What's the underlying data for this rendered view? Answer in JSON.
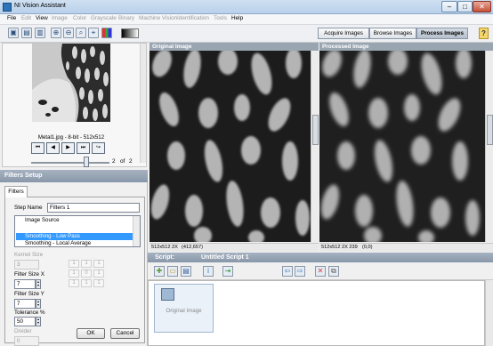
{
  "window": {
    "title": "NI Vision Assistant",
    "minimize": "–",
    "maximize": "□",
    "close": "✕"
  },
  "menu": [
    {
      "label": "File",
      "enabled": true
    },
    {
      "label": "Edit",
      "enabled": false
    },
    {
      "label": "View",
      "enabled": true
    },
    {
      "label": "Image",
      "enabled": false
    },
    {
      "label": "Color",
      "enabled": false
    },
    {
      "label": "Grayscale",
      "enabled": false
    },
    {
      "label": "Binary",
      "enabled": false
    },
    {
      "label": "Machine Vision",
      "enabled": false
    },
    {
      "label": "Identification",
      "enabled": false
    },
    {
      "label": "Tools",
      "enabled": false
    },
    {
      "label": "Help",
      "enabled": true
    }
  ],
  "toolbar": {
    "icons": [
      "open-image-icon",
      "save-image-icon",
      "print-icon",
      "zoom-in-icon",
      "zoom-out-icon",
      "zoom-fit-icon",
      "zoom-actual-icon",
      "palette-icon"
    ],
    "mode_tabs": [
      "Acquire Images",
      "Browse Images",
      "Process Images"
    ],
    "active_tab": "Process Images",
    "help": "?"
  },
  "thumbnail": {
    "caption": "Metal1.jpg - 8-bit - 512x512",
    "nav": [
      "⏮",
      "◀",
      "▶",
      "⏭",
      "↪"
    ],
    "page_current": "2",
    "page_of": "of",
    "page_total": "2",
    "slider_fraction": 0.9
  },
  "filters_setup": {
    "header": "Filters Setup",
    "tab": "Filters",
    "step_name_label": "Step Name",
    "step_name_value": "Filters 1",
    "list_items": [
      "Image Source",
      "",
      "Smoothing - Low Pass",
      "Smoothing - Local Average"
    ],
    "selected_index": 2,
    "kernel_size_label": "Kernel Size",
    "kernel_size_value": "3",
    "filter_size_x_label": "Filter Size X",
    "filter_size_x_value": "7",
    "filter_size_y_label": "Filter Size Y",
    "filter_size_y_value": "7",
    "tolerance_label": "Tolerance %",
    "tolerance_value": "50",
    "divider_label": "Divider",
    "divider_value": "0",
    "kernel": [
      "1",
      "1",
      "1",
      "1",
      "0",
      "1",
      "1",
      "1",
      "1"
    ],
    "ok": "OK",
    "cancel": "Cancel"
  },
  "panes": {
    "original": {
      "title": "Original Image",
      "status_size": "512x512 2X",
      "status_coords": "(412,657)"
    },
    "processed": {
      "title": "Processed Image",
      "status_size": "512x512 2X 239",
      "status_coords": "(0,0)"
    }
  },
  "script": {
    "label": "Script:",
    "name": "Untitled Script 1",
    "tool_icons": [
      "new-script-icon",
      "open-script-icon",
      "save-script-icon",
      "info-icon",
      "run-script-icon",
      "step-back-icon",
      "step-forward-icon",
      "delete-step-icon",
      "copy-step-icon"
    ],
    "steps": [
      {
        "label": "Original Image"
      }
    ]
  },
  "colors": {
    "accent": "#3399ff",
    "panel_header": "#8897a9",
    "image_bg": "#1a1a1a",
    "blob": "#b9b9b9"
  }
}
